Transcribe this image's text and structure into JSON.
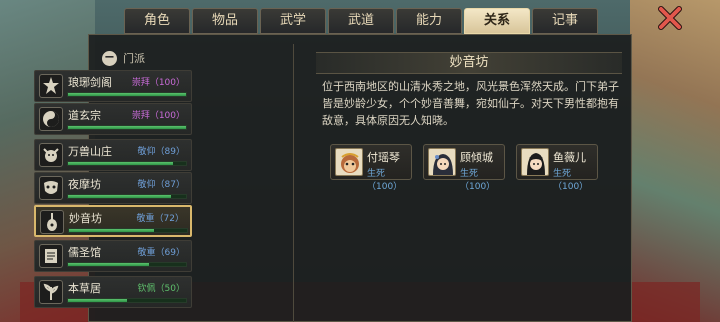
{
  "tabs": [
    {
      "label": "角色",
      "active": false
    },
    {
      "label": "物品",
      "active": false
    },
    {
      "label": "武学",
      "active": false
    },
    {
      "label": "武道",
      "active": false
    },
    {
      "label": "能力",
      "active": false
    },
    {
      "label": "关系",
      "active": true
    },
    {
      "label": "记事",
      "active": false
    }
  ],
  "section": {
    "title": "门派"
  },
  "factions": [
    {
      "name": "琅琊剑阁",
      "status": "崇拜（100）",
      "status_color": "#c96bd8",
      "level": 1.0,
      "icon": "sword-pavilion-icon"
    },
    {
      "name": "道玄宗",
      "status": "崇拜（100）",
      "status_color": "#c96bd8",
      "level": 1.0,
      "icon": "taiji-icon"
    },
    {
      "name": "万兽山庄",
      "status": "敬仰（89）",
      "status_color": "#6f9fd8",
      "level": 0.89,
      "icon": "beast-icon"
    },
    {
      "name": "夜摩坊",
      "status": "敬仰（87）",
      "status_color": "#6f9fd8",
      "level": 0.87,
      "icon": "demon-mask-icon"
    },
    {
      "name": "妙音坊",
      "status": "敬重（72）",
      "status_color": "#6f9fd8",
      "level": 0.72,
      "icon": "lute-icon",
      "selected": true
    },
    {
      "name": "儒圣馆",
      "status": "敬重（69）",
      "status_color": "#6f9fd8",
      "level": 0.69,
      "icon": "scroll-icon"
    },
    {
      "name": "本草居",
      "status": "钦佩（50）",
      "status_color": "#5fbf6c",
      "level": 0.5,
      "icon": "herb-icon"
    }
  ],
  "detail": {
    "title": "妙音坊",
    "description": "位于西南地区的山清水秀之地，风光景色浑然天成。门下弟子皆是妙龄少女，个个妙音善舞，宛如仙子。对天下男性都抱有敌意，具体原因无人知晓。"
  },
  "members": [
    {
      "name": "付瑶琴",
      "status": "生死（100）",
      "portrait": "monkey-portrait-icon"
    },
    {
      "name": "顾倾城",
      "status": "生死（100）",
      "portrait": "lady-portrait-icon"
    },
    {
      "name": "鱼薇儿",
      "status": "生死（100）",
      "portrait": "girl-portrait-icon"
    }
  ]
}
